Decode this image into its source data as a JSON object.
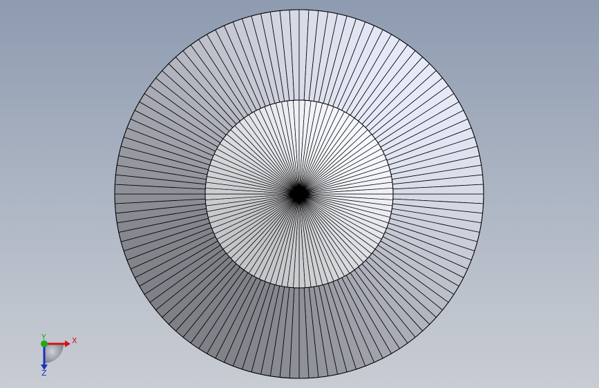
{
  "viewport": {
    "model_name": "revolved-fan-disc",
    "background_top": "#8e9bb0",
    "background_bottom": "#c8ccd3"
  },
  "model": {
    "outer_segments": 120,
    "inner_segments": 100,
    "edge_color": "#000000",
    "outer_face_light": "#e6eaf8",
    "outer_face_dark": "#7e8086",
    "inner_face_light": "#f7f8fd",
    "inner_face_dark": "#c4c5c9"
  },
  "triad": {
    "x_label": "X",
    "y_label": "Y",
    "z_label": "Z",
    "x_color": "#d21414",
    "y_color": "#1fa81f",
    "z_color": "#1f2fbf"
  }
}
